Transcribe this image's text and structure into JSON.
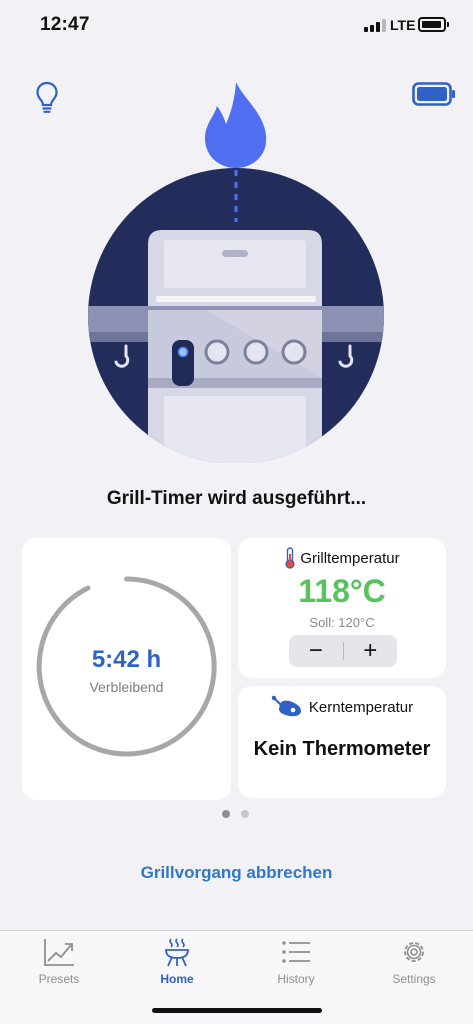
{
  "status_bar": {
    "time": "12:47",
    "network": "LTE",
    "phone_battery_level": 0.8
  },
  "header": {
    "left_icon": "lightbulb-icon",
    "right_icon": "battery-icon"
  },
  "hero": {
    "flame_icon": "flame-icon",
    "illustration": "gas-grill-illustration"
  },
  "status_message": "Grill-Timer wird ausgeführt...",
  "timer_card": {
    "value": "5:42 h",
    "label": "Verbleibend",
    "ring_color": "#a7a7a7"
  },
  "grill_card": {
    "icon": "thermometer-icon",
    "title": "Grilltemperatur",
    "value": "118°C",
    "value_color": "#58c35a",
    "setpoint": "Soll: 120°C",
    "minus": "−",
    "plus": "+"
  },
  "core_card": {
    "icon": "meat-probe-icon",
    "title": "Kerntemperatur",
    "value": "Kein Thermometer"
  },
  "pagination": {
    "pages": 2,
    "current": 1
  },
  "cancel_label": "Grillvorgang abbrechen",
  "tabs": [
    {
      "label": "Presets",
      "icon": "chart-icon",
      "active": false
    },
    {
      "label": "Home",
      "icon": "grill-icon",
      "active": true
    },
    {
      "label": "History",
      "icon": "list-icon",
      "active": false
    },
    {
      "label": "Settings",
      "icon": "gear-icon",
      "active": false
    }
  ],
  "colors": {
    "accent": "#2f62c6",
    "link": "#2f78c8",
    "illustration_bg": "#232d5c",
    "flame": "#4f6ef0"
  }
}
